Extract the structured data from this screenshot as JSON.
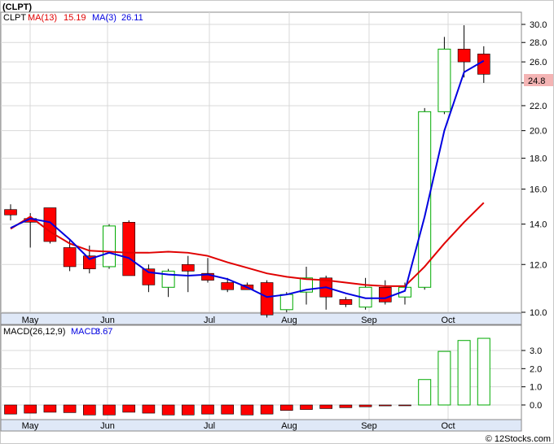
{
  "header": {
    "symbol": "(CLPT)"
  },
  "price_panel": {
    "legend": {
      "symbol": "CLPT",
      "ma13_label": "MA(13)",
      "ma13_value": "15.19",
      "ma3_label": "MA(3)",
      "ma3_value": "26.11"
    },
    "last_price_label": "24.8",
    "yticks": [
      "10.0",
      "12.0",
      "14.0",
      "16.0",
      "18.0",
      "20.0",
      "22.0",
      "24.0",
      "26.0",
      "28.0",
      "30.0"
    ],
    "months": [
      "May",
      "Jun",
      "Jul",
      "Aug",
      "Sep",
      "Oct"
    ]
  },
  "macd_panel": {
    "legend": {
      "label": "MACD(26,12,9)",
      "macd_label": "MACD:",
      "macd_value": "3.67"
    },
    "yticks": [
      "0.0",
      "1.0",
      "2.0",
      "3.0"
    ],
    "months": [
      "May",
      "Jun",
      "Jul",
      "Aug",
      "Sep",
      "Oct"
    ]
  },
  "footer": {
    "copyright": "© 12Stocks.com"
  },
  "colors": {
    "up": "#00aa00",
    "down": "#ff0000",
    "ma13": "#e00000",
    "ma3": "#0000e0",
    "axis_band": "#dfe8f7",
    "last_price_bg": "#f4b4b4"
  },
  "chart_data": [
    {
      "type": "candlestick",
      "title": "CLPT",
      "scale": "log",
      "ylim": [
        9.8,
        31.0
      ],
      "x_ticks": [
        "May",
        "Jun",
        "Jul",
        "Aug",
        "Sep",
        "Oct"
      ],
      "candles": [
        {
          "o": 14.8,
          "h": 15.1,
          "l": 14.2,
          "c": 14.5
        },
        {
          "o": 14.3,
          "h": 14.6,
          "l": 12.8,
          "c": 14.1
        },
        {
          "o": 14.9,
          "h": 14.9,
          "l": 13.0,
          "c": 13.1
        },
        {
          "o": 12.8,
          "h": 13.2,
          "l": 11.7,
          "c": 11.9
        },
        {
          "o": 12.4,
          "h": 12.9,
          "l": 11.6,
          "c": 11.8
        },
        {
          "o": 11.9,
          "h": 14.0,
          "l": 11.8,
          "c": 13.9
        },
        {
          "o": 14.1,
          "h": 14.2,
          "l": 11.5,
          "c": 11.5
        },
        {
          "o": 11.8,
          "h": 12.0,
          "l": 10.8,
          "c": 11.1
        },
        {
          "o": 11.0,
          "h": 11.8,
          "l": 10.6,
          "c": 11.7
        },
        {
          "o": 12.0,
          "h": 12.4,
          "l": 10.8,
          "c": 11.7
        },
        {
          "o": 11.6,
          "h": 12.3,
          "l": 11.2,
          "c": 11.3
        },
        {
          "o": 11.2,
          "h": 11.4,
          "l": 10.8,
          "c": 10.9
        },
        {
          "o": 11.1,
          "h": 11.2,
          "l": 10.9,
          "c": 10.9
        },
        {
          "o": 11.2,
          "h": 11.3,
          "l": 9.8,
          "c": 9.9
        },
        {
          "o": 10.1,
          "h": 10.8,
          "l": 10.0,
          "c": 10.7
        },
        {
          "o": 10.8,
          "h": 11.9,
          "l": 10.3,
          "c": 11.4
        },
        {
          "o": 11.4,
          "h": 11.5,
          "l": 10.1,
          "c": 10.6
        },
        {
          "o": 10.5,
          "h": 10.6,
          "l": 10.2,
          "c": 10.3
        },
        {
          "o": 10.2,
          "h": 11.4,
          "l": 10.1,
          "c": 11.0
        },
        {
          "o": 11.0,
          "h": 11.3,
          "l": 10.3,
          "c": 10.4
        },
        {
          "o": 10.6,
          "h": 11.2,
          "l": 10.3,
          "c": 11.0
        },
        {
          "o": 11.0,
          "h": 21.8,
          "l": 10.9,
          "c": 21.5
        },
        {
          "o": 21.5,
          "h": 28.6,
          "l": 21.3,
          "c": 27.3
        },
        {
          "o": 27.3,
          "h": 29.9,
          "l": 24.5,
          "c": 26.0
        },
        {
          "o": 26.8,
          "h": 27.6,
          "l": 24.0,
          "c": 24.8
        }
      ],
      "series": [
        {
          "name": "MA(13)",
          "values": [
            13.75,
            14.4,
            13.6,
            13.0,
            12.65,
            12.6,
            12.55,
            12.55,
            12.6,
            12.55,
            12.4,
            12.1,
            11.85,
            11.6,
            11.45,
            11.35,
            11.3,
            11.2,
            11.1,
            11.05,
            11.05,
            11.9,
            13.0,
            14.1,
            15.19
          ]
        },
        {
          "name": "MA(3)",
          "values": [
            13.8,
            14.3,
            14.1,
            13.2,
            12.25,
            12.55,
            12.3,
            11.65,
            11.55,
            11.5,
            11.55,
            11.35,
            11.0,
            10.6,
            10.7,
            10.9,
            11.0,
            10.75,
            10.55,
            10.55,
            10.85,
            14.4,
            20.0,
            25.0,
            26.11
          ]
        }
      ]
    },
    {
      "type": "bar",
      "title": "MACD(26,12,9)",
      "ylabel": "",
      "ylim": [
        -0.6,
        4.3
      ],
      "x_ticks": [
        "May",
        "Jun",
        "Jul",
        "Aug",
        "Sep",
        "Oct"
      ],
      "values": [
        -0.5,
        -0.45,
        -0.4,
        -0.42,
        -0.55,
        -0.55,
        -0.4,
        -0.45,
        -0.55,
        -0.55,
        -0.5,
        -0.5,
        -0.55,
        -0.5,
        -0.3,
        -0.25,
        -0.2,
        -0.15,
        -0.1,
        -0.05,
        0.0,
        1.4,
        2.95,
        3.55,
        3.67
      ]
    }
  ]
}
